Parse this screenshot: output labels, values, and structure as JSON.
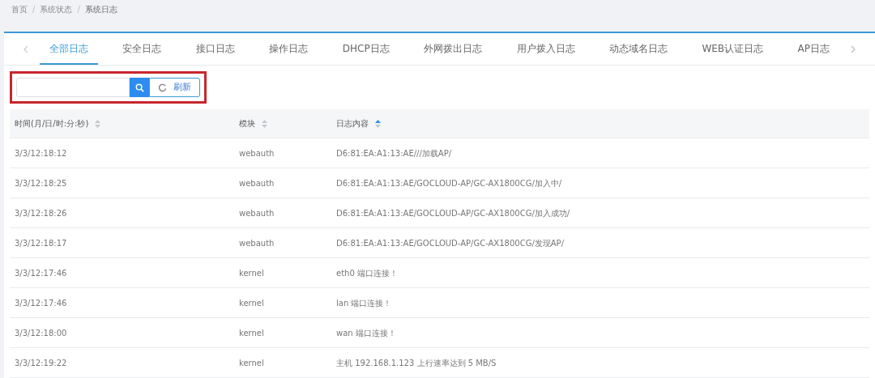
{
  "breadcrumb": {
    "separator": "/",
    "items": [
      "首页",
      "系统状态",
      "系统日志"
    ]
  },
  "tabs": [
    {
      "label": "全部日志",
      "selected": true
    },
    {
      "label": "安全日志",
      "selected": false
    },
    {
      "label": "接口日志",
      "selected": false
    },
    {
      "label": "操作日志",
      "selected": false
    },
    {
      "label": "DHCP日志",
      "selected": false
    },
    {
      "label": "外网拨出日志",
      "selected": false
    },
    {
      "label": "用户拨入日志",
      "selected": false
    },
    {
      "label": "动态域名日志",
      "selected": false
    },
    {
      "label": "WEB认证日志",
      "selected": false
    },
    {
      "label": "AP日志",
      "selected": false
    }
  ],
  "toolbar": {
    "refresh_label": "刷新",
    "highlighted": true
  },
  "table": {
    "columns": [
      {
        "label": "时间(月/日/时:分:秒)",
        "sorted": false
      },
      {
        "label": "模块",
        "sorted": false
      },
      {
        "label": "日志内容",
        "sorted": true
      }
    ],
    "rows": [
      [
        "3/3/12:18:12",
        "webauth",
        "D6:81:EA:A1:13:AE///加载AP/"
      ],
      [
        "3/3/12:18:25",
        "webauth",
        "D6:81:EA:A1:13:AE/GOCLOUD-AP/GC-AX1800CG/加入中/"
      ],
      [
        "3/3/12:18:26",
        "webauth",
        "D6:81:EA:A1:13:AE/GOCLOUD-AP/GC-AX1800CG/加入成功/"
      ],
      [
        "3/3/12:18:17",
        "webauth",
        "D6:81:EA:A1:13:AE/GOCLOUD-AP/GC-AX1800CG/发现AP/"
      ],
      [
        "3/3/12:17:46",
        "kernel",
        "eth0 端口连接！"
      ],
      [
        "3/3/12:17:46",
        "kernel",
        "lan 端口连接！"
      ],
      [
        "3/3/12:18:00",
        "kernel",
        "wan 端口连接！"
      ],
      [
        "3/3/12:19:22",
        "kernel",
        "主机 192.168.1.123 上行速率达到 5 MB/S"
      ]
    ]
  }
}
